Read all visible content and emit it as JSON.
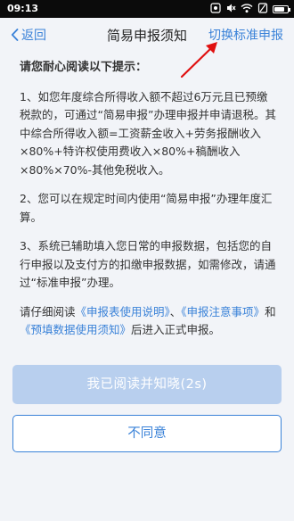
{
  "status_bar": {
    "time": "09:13",
    "icons": [
      "notification-icon",
      "mute-icon",
      "wifi-icon",
      "sim-blocked-icon",
      "battery-icon"
    ],
    "battery_level": 0.75
  },
  "nav": {
    "back_label": "返回",
    "title": "简易申报须知",
    "switch_label": "切换标准申报",
    "accent_color": "#3a82d8"
  },
  "content": {
    "heading": "请您耐心阅读以下提示：",
    "item1": "1、如您年度综合所得收入额不超过6万元且已预缴税款的，可通过“简易申报”办理申报并申请退税。其中综合所得收入额=工资薪金收入+劳务报酬收入×80%+特许权使用费收入×80%+稿酬收入×80%×70%-其他免税收入。",
    "item2": "2、您可以在规定时间内使用“简易申报”办理年度汇算。",
    "item3_pre": "3、系统已辅助填入您日常的申报数据，包括您的自行申报以及支付方的扣缴申报数据，如需修改，请通过",
    "item3_link": "“标准申报”",
    "item3_post": "办理。",
    "notice_pre": "请仔细阅读",
    "notice_link1": "《申报表使用说明》",
    "notice_sep1": "、",
    "notice_link2": "《申报注意事项》",
    "notice_sep2": "和",
    "notice_link3": "《预填数据使用须知》",
    "notice_post": "后进入正式申报。"
  },
  "buttons": {
    "agree_label": "我已阅读并知晓(2s)",
    "disagree_label": "不同意"
  }
}
